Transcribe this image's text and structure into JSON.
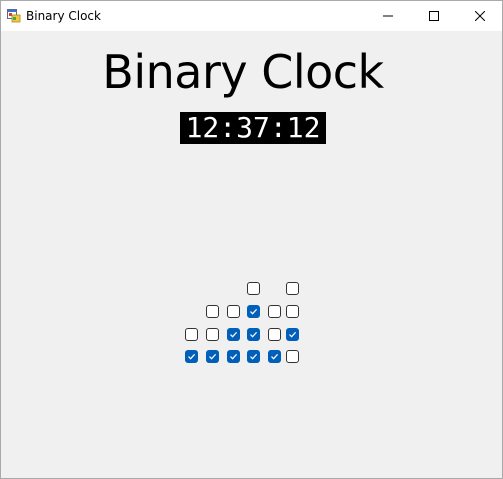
{
  "window": {
    "title": "Binary Clock",
    "app_icon": "winforms-app-icon",
    "controls": [
      "minimize-icon",
      "maximize-icon",
      "close-icon"
    ]
  },
  "heading": "Binary Clock",
  "time": "12:37:12",
  "colors": {
    "checked": "#005fb8",
    "time_background": "#000000",
    "time_text": "#ffffff",
    "window_background": "#f0f0f0"
  },
  "binary_columns": [
    {
      "digit": "1",
      "bits": [
        0,
        1
      ]
    },
    {
      "digit": "2",
      "bits": [
        0,
        0,
        1
      ]
    },
    {
      "digit": "3",
      "bits": [
        0,
        1,
        1
      ]
    },
    {
      "digit": "7",
      "bits": [
        0,
        1,
        1,
        1
      ]
    },
    {
      "digit": "1",
      "bits": [
        0,
        0,
        1
      ]
    },
    {
      "digit": "2",
      "bits": [
        0,
        0,
        1,
        0
      ]
    }
  ]
}
